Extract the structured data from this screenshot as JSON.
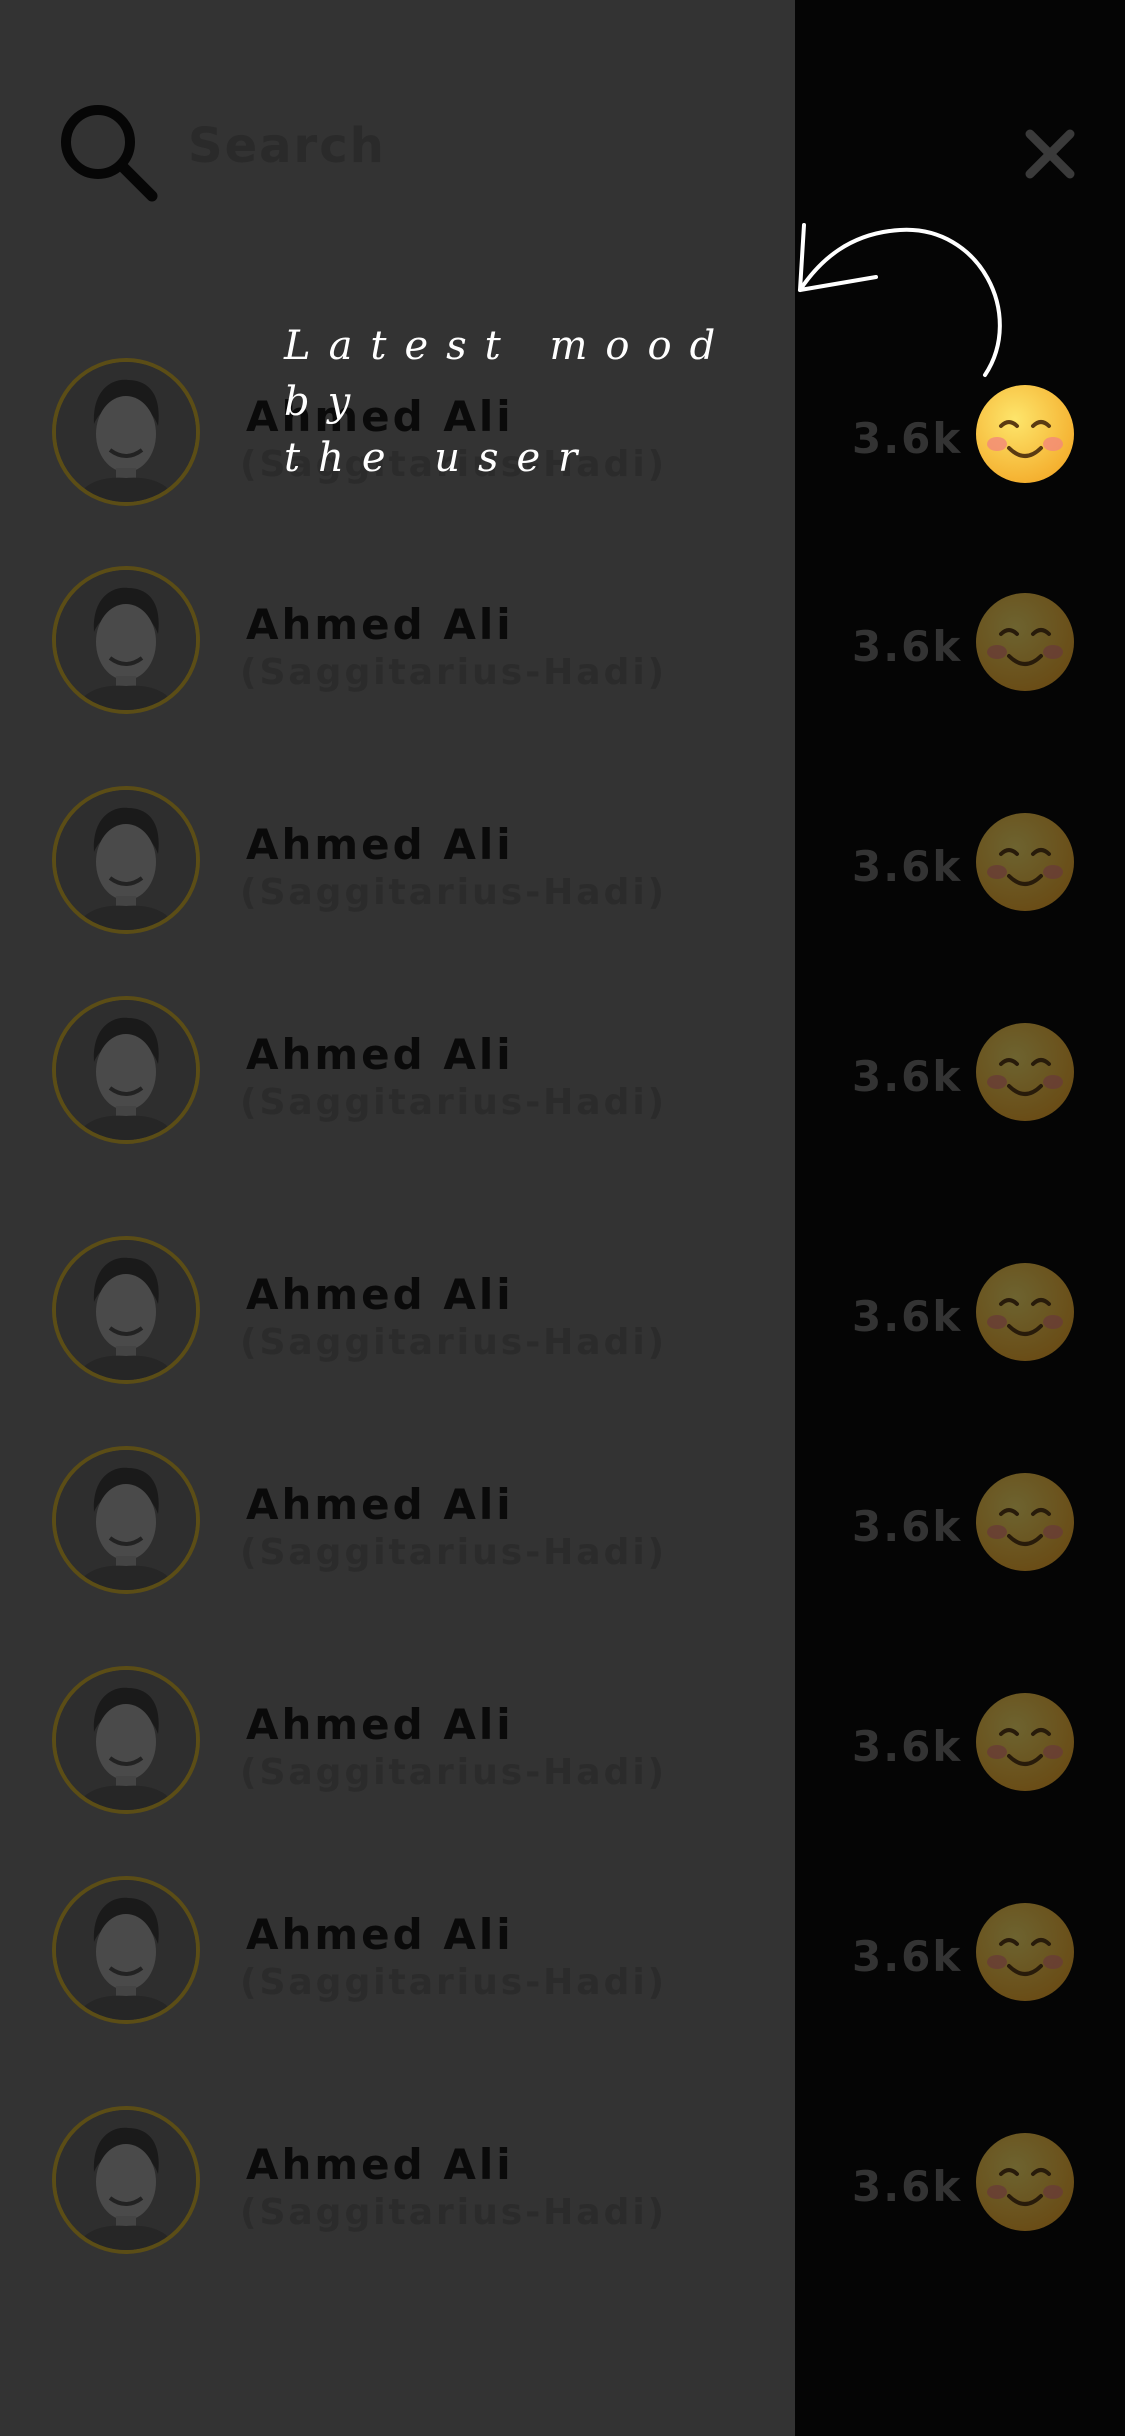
{
  "search": {
    "placeholder": "Search"
  },
  "users": [
    {
      "name": "Ahmed Ali",
      "subtitle": "(Saggitarius-Hadi)",
      "count": "3.6k",
      "mood": "smiling-face-emoji",
      "highlighted": true
    },
    {
      "name": "Ahmed Ali",
      "subtitle": "(Saggitarius-Hadi)",
      "count": "3.6k",
      "mood": "smiling-face-emoji",
      "highlighted": false
    },
    {
      "name": "Ahmed Ali",
      "subtitle": "(Saggitarius-Hadi)",
      "count": "3.6k",
      "mood": "smiling-face-emoji",
      "highlighted": false
    },
    {
      "name": "Ahmed Ali",
      "subtitle": "(Saggitarius-Hadi)",
      "count": "3.6k",
      "mood": "smiling-face-emoji",
      "highlighted": false
    },
    {
      "name": "Ahmed Ali",
      "subtitle": "(Saggitarius-Hadi)",
      "count": "3.6k",
      "mood": "smiling-face-emoji",
      "highlighted": false
    },
    {
      "name": "Ahmed Ali",
      "subtitle": "(Saggitarius-Hadi)",
      "count": "3.6k",
      "mood": "smiling-face-emoji",
      "highlighted": false
    },
    {
      "name": "Ahmed Ali",
      "subtitle": "(Saggitarius-Hadi)",
      "count": "3.6k",
      "mood": "smiling-face-emoji",
      "highlighted": false
    },
    {
      "name": "Ahmed Ali",
      "subtitle": "(Saggitarius-Hadi)",
      "count": "3.6k",
      "mood": "smiling-face-emoji",
      "highlighted": false
    },
    {
      "name": "Ahmed Ali",
      "subtitle": "(Saggitarius-Hadi)",
      "count": "3.6k",
      "mood": "smiling-face-emoji",
      "highlighted": false
    }
  ],
  "annotation": {
    "text": "Latest mood by\nthe user"
  },
  "icons": {
    "search": "search-icon",
    "close": "close-icon"
  },
  "colors": {
    "panel": "#333333",
    "overlay": "#050505",
    "avatar_ring": "#5b4d16",
    "emoji": "#f7c53f"
  }
}
